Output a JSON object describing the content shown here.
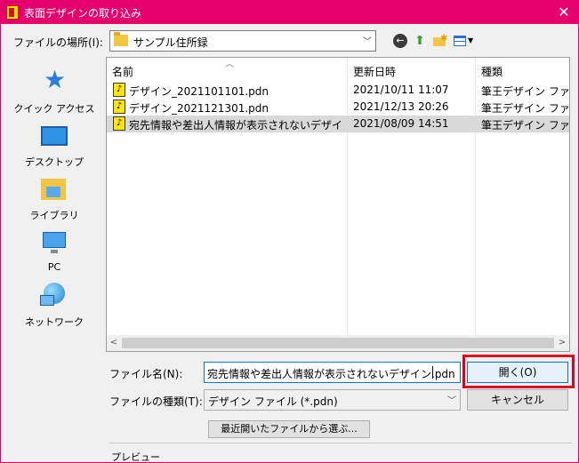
{
  "window": {
    "title": "表面デザインの取り込み",
    "close": "✕"
  },
  "location": {
    "label": "ファイルの場所(I):",
    "value": "サンプル住所録"
  },
  "places": [
    "クイック アクセス",
    "デスクトップ",
    "ライブラリ",
    "PC",
    "ネットワーク"
  ],
  "columns": {
    "name": "名前",
    "date": "更新日時",
    "type": "種類"
  },
  "files": [
    {
      "name": "デザイン_2021101101.pdn",
      "date": "2021/10/11 11:07",
      "type": "筆王デザイン ファイル",
      "selected": false
    },
    {
      "name": "デザイン_2021121301.pdn",
      "date": "2021/12/13 20:26",
      "type": "筆王デザイン ファイル",
      "selected": false
    },
    {
      "name": "宛先情報や差出人情報が表示されないデザイン ...",
      "date": "2021/08/09 14:51",
      "type": "筆王デザイン ファイル",
      "selected": true
    }
  ],
  "filename": {
    "label": "ファイル名(N):",
    "value": "宛先情報や差出人情報が表示されないデザイン.pdn"
  },
  "filetype": {
    "label": "ファイルの種類(T):",
    "value": "デザイン ファイル (*.pdn)"
  },
  "buttons": {
    "open": "開く(O)",
    "cancel": "キャンセル",
    "recent": "最近開いたファイルから選ぶ..."
  },
  "preview_label": "プレビュー",
  "colors": {
    "titlebar": "#e6006e",
    "highlight": "#e1001e",
    "selected_row": "#d9d9d9"
  }
}
